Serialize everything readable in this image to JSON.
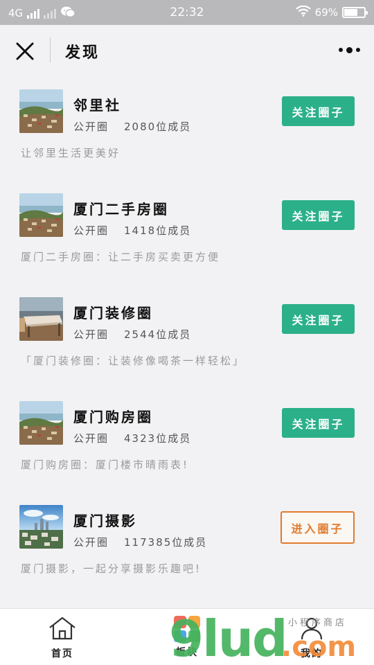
{
  "status_bar": {
    "network": "4G",
    "time": "22:32",
    "battery": "69%",
    "battery_level": 0.69
  },
  "nav": {
    "title": "发现"
  },
  "groups": [
    {
      "name": "邻里社",
      "type": "公开圈",
      "members": "2080位成员",
      "desc": "让邻里生活更美好",
      "button": "关注圈子",
      "button_kind": "follow",
      "thumb": "coastal-town"
    },
    {
      "name": "厦门二手房圈",
      "type": "公开圈",
      "members": "1418位成员",
      "desc": "厦门二手房圈：让二手房买卖更方便",
      "button": "关注圈子",
      "button_kind": "follow",
      "thumb": "coastal-town"
    },
    {
      "name": "厦门装修圈",
      "type": "公开圈",
      "members": "2544位成员",
      "desc": "「厦门装修圈：让装修像喝茶一样轻松」",
      "button": "关注圈子",
      "button_kind": "follow",
      "thumb": "wooden-table"
    },
    {
      "name": "厦门购房圈",
      "type": "公开圈",
      "members": "4323位成员",
      "desc": "厦门购房圈：厦门楼市晴雨表!",
      "button": "关注圈子",
      "button_kind": "follow",
      "thumb": "coastal-town"
    },
    {
      "name": "厦门摄影",
      "type": "公开圈",
      "members": "117385位成员",
      "desc": "厦门摄影，一起分享摄影乐趣吧!",
      "button": "进入圈子",
      "button_kind": "enter",
      "thumb": "city-skyline"
    }
  ],
  "tabs": [
    {
      "label": "首页",
      "icon": "home-icon"
    },
    {
      "label": "板块",
      "icon": "grid-icon"
    },
    {
      "label": "我的",
      "icon": "user-icon"
    }
  ],
  "watermark": {
    "big": "9lud",
    "dotcom": ".com",
    "small": "小程序商店"
  },
  "colors": {
    "follow_button": "#2bb08a",
    "enter_button": "#e07a2e",
    "status_bar": "#b9b9bb"
  }
}
